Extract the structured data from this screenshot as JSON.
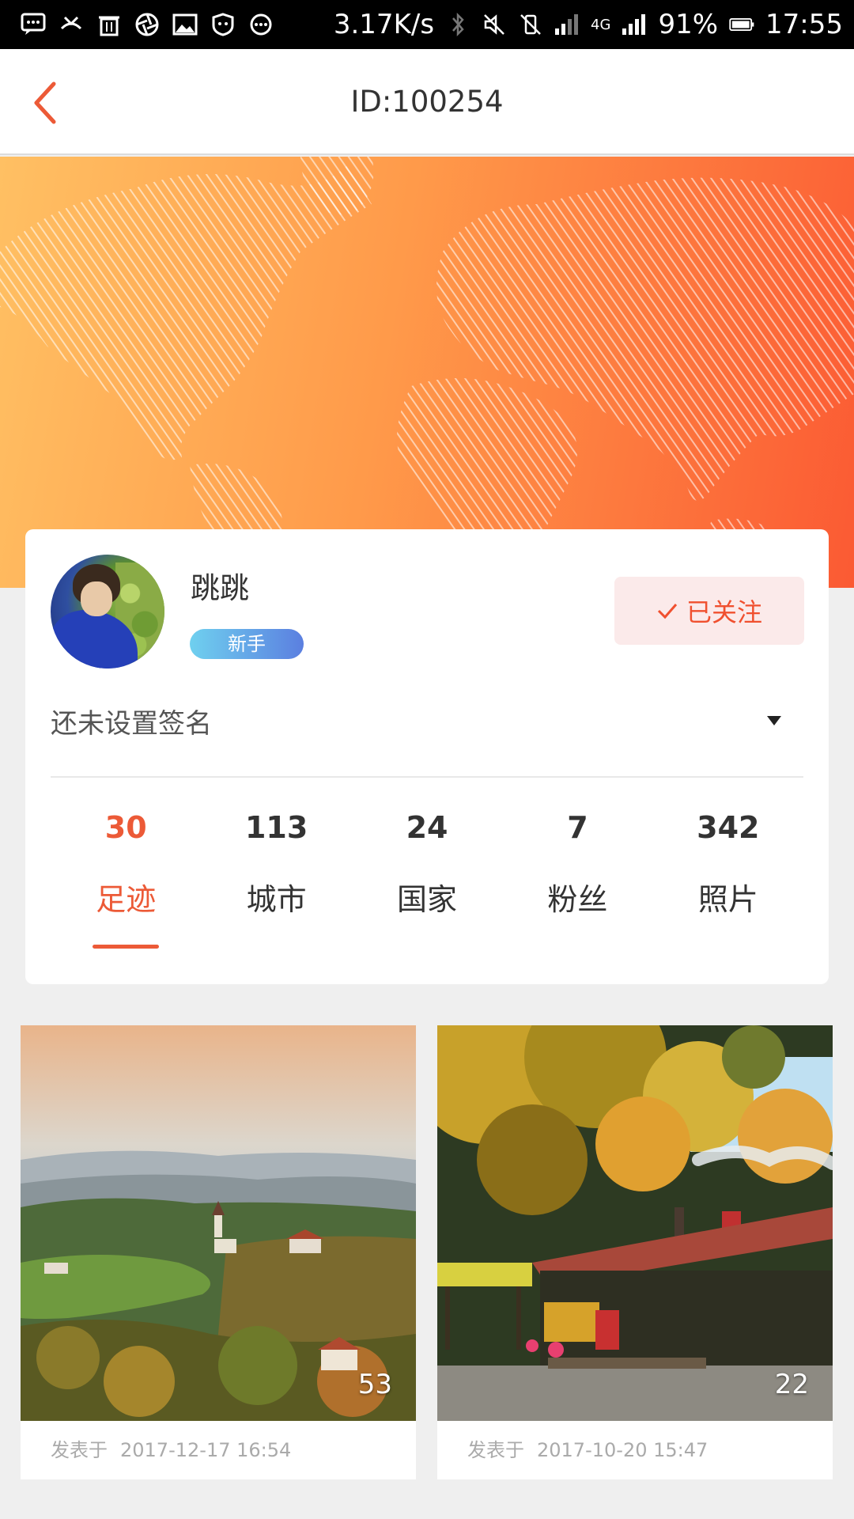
{
  "status_bar": {
    "net_speed": "3.17K/s",
    "network": "4G",
    "battery": "91%",
    "time": "17:55"
  },
  "nav": {
    "title": "ID:100254"
  },
  "profile": {
    "name": "跳跳",
    "badge": "新手",
    "follow_label": "已关注",
    "signature": "还未设置签名"
  },
  "stats": [
    {
      "value": "30",
      "label": "足迹",
      "active": true
    },
    {
      "value": "113",
      "label": "城市"
    },
    {
      "value": "24",
      "label": "国家"
    },
    {
      "value": "7",
      "label": "粉丝"
    },
    {
      "value": "342",
      "label": "照片"
    }
  ],
  "posts": [
    {
      "count": "53",
      "prefix": "发表于",
      "date": "2017-12-17 16:54"
    },
    {
      "count": "22",
      "prefix": "发表于",
      "date": "2017-10-20 15:47"
    }
  ],
  "colors": {
    "accent": "#ec5a37",
    "banner_start": "#ffc063",
    "banner_end": "#fb5a33"
  }
}
